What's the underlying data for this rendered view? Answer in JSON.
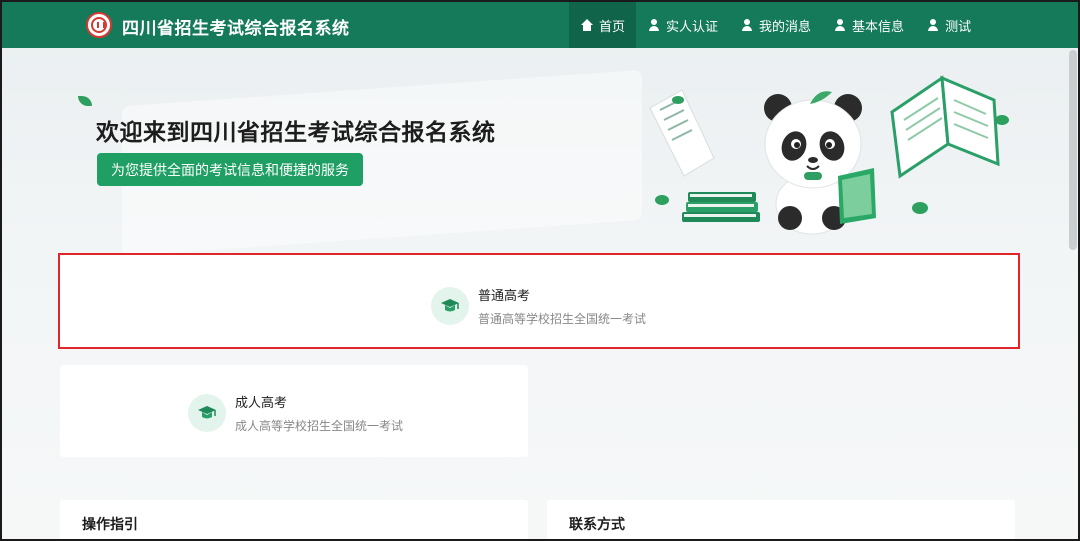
{
  "header": {
    "site_title": "四川省招生考试综合报名系统",
    "nav": [
      {
        "label": "首页",
        "icon": "home-icon",
        "active": true
      },
      {
        "label": "实人认证",
        "icon": "user-icon"
      },
      {
        "label": "我的消息",
        "icon": "user-icon"
      },
      {
        "label": "基本信息",
        "icon": "user-icon"
      },
      {
        "label": "测试",
        "icon": "user-icon"
      }
    ]
  },
  "hero": {
    "title": "欢迎来到四川省招生考试综合报名系统",
    "subtitle": "为您提供全面的考试信息和便捷的服务"
  },
  "exams": [
    {
      "name": "普通高考",
      "desc": "普通高等学校招生全国统一考试",
      "icon": "graduation-cap-icon"
    },
    {
      "name": "成人高考",
      "desc": "成人高等学校招生全国统一考试",
      "icon": "graduation-cap-icon"
    }
  ],
  "sections": {
    "guide_title": "操作指引",
    "contact_title": "联系方式"
  },
  "colors": {
    "brand_green": "#157a5a",
    "accent_green": "#1f9f63",
    "highlight_red": "#e0262a"
  }
}
